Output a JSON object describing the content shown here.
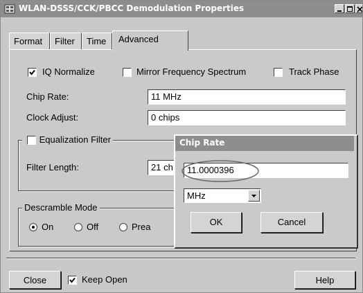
{
  "window": {
    "title": "WLAN-DSSS/CCK/PBCC Demodulation Properties",
    "title_buttons": [
      "minimize-icon",
      "maximize-icon",
      "close-icon"
    ]
  },
  "tabs": [
    {
      "label": "Format",
      "active": false
    },
    {
      "label": "Filter",
      "active": false
    },
    {
      "label": "Time",
      "active": false
    },
    {
      "label": "Advanced",
      "active": true
    }
  ],
  "advanced": {
    "iq_normalize": {
      "label": "IQ Normalize",
      "checked": true
    },
    "mirror_spectrum": {
      "label": "Mirror Frequency Spectrum",
      "checked": false
    },
    "track_phase": {
      "label": "Track Phase",
      "checked": false
    },
    "chip_rate": {
      "label": "Chip Rate:",
      "value": "11 MHz"
    },
    "clock_adjust": {
      "label": "Clock Adjust:",
      "value": "0 chips"
    },
    "equalization": {
      "label": "Equalization Filter",
      "checked": false,
      "filter_length_label": "Filter Length:",
      "filter_length_value": "21 ch"
    },
    "descramble": {
      "label": "Descramble Mode",
      "options": [
        {
          "label": "On",
          "selected": true
        },
        {
          "label": "Off",
          "selected": false
        },
        {
          "label": "Prea",
          "selected": false
        }
      ]
    }
  },
  "popup": {
    "title": "Chip Rate",
    "value": "11.0000396",
    "unit": "MHz",
    "ok_label": "OK",
    "cancel_label": "Cancel"
  },
  "footer": {
    "close_label": "Close",
    "keep_open_label": "Keep Open",
    "keep_open_checked": true,
    "help_label": "Help"
  },
  "colors": {
    "titlebar": "#8d8d8d",
    "face": "#cacaca",
    "highlight_ellipse": "#6a6a6a"
  }
}
